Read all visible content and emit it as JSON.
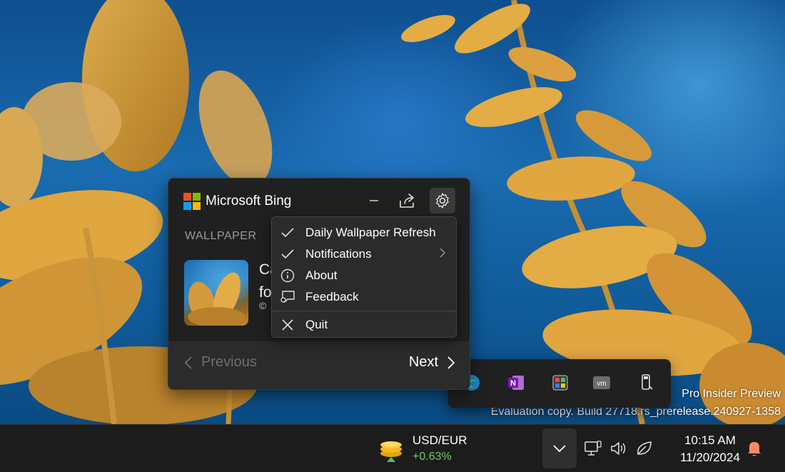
{
  "desktop": {
    "watermark_line1": "Pro Insider Preview",
    "watermark_line2": "Evaluation copy. Build 27718.rs_prerelease.240927-1358"
  },
  "bing": {
    "app_title": "Microsoft Bing",
    "section_label": "WALLPAPER",
    "wallpaper_title_line1": "Ca",
    "wallpaper_title_line2": "fo",
    "wallpaper_copyright": "©",
    "prev_label": "Previous",
    "next_label": "Next"
  },
  "settings_menu": {
    "items": [
      {
        "label": "Daily Wallpaper Refresh",
        "icon": "check-icon",
        "checked": true
      },
      {
        "label": "Notifications",
        "icon": "check-icon",
        "checked": true,
        "has_submenu": true
      },
      {
        "label": "About",
        "icon": "info-icon"
      },
      {
        "label": "Feedback",
        "icon": "feedback-icon"
      },
      {
        "label": "Quit",
        "icon": "close-icon"
      }
    ]
  },
  "tray_overflow": {
    "icons": [
      "edge-icon",
      "onenote-icon",
      "color-picker-icon",
      "vmware-icon",
      "usb-eject-icon"
    ]
  },
  "taskbar": {
    "widget": {
      "pair": "USD/EUR",
      "change": "+0.63%",
      "change_color": "#6ccb5f"
    },
    "clock": {
      "time": "10:15 AM",
      "date": "11/20/2024"
    },
    "system_icons": [
      "network-icon",
      "volume-icon",
      "battery-saver-icon"
    ],
    "notification_color": "#ff8a65"
  }
}
